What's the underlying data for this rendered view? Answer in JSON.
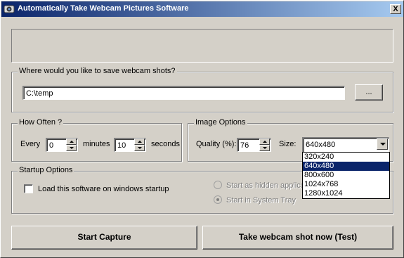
{
  "window": {
    "title": "Automatically Take Webcam Pictures Software",
    "close_label": "X"
  },
  "save": {
    "group_label": "Where would you like to save webcam shots?",
    "path_value": "C:\\temp",
    "browse_label": "..."
  },
  "how_often": {
    "group_label": "How Often ?",
    "every_label": "Every",
    "minutes_value": "0",
    "minutes_label": "minutes",
    "seconds_value": "10",
    "seconds_label": "seconds"
  },
  "image_options": {
    "group_label": "Image Options",
    "quality_label": "Quality (%):",
    "quality_value": "76",
    "size_label": "Size:",
    "size_value": "640x480",
    "size_options": [
      "320x240",
      "640x480",
      "800x600",
      "1024x768",
      "1280x1024"
    ],
    "selected_index": 1
  },
  "startup": {
    "group_label": "Startup Options",
    "load_on_startup_label": "Load this software on windows startup",
    "load_on_startup_checked": false,
    "hidden_app_label": "Start as hidden applica",
    "system_tray_label": "Start in System Tray"
  },
  "actions": {
    "start_capture_label": "Start Capture",
    "test_label": "Take webcam shot now (Test)"
  },
  "colors": {
    "title_gradient_start": "#0a246a",
    "title_gradient_end": "#a6caf0",
    "selection": "#0a246a",
    "face": "#d4d0c8"
  }
}
